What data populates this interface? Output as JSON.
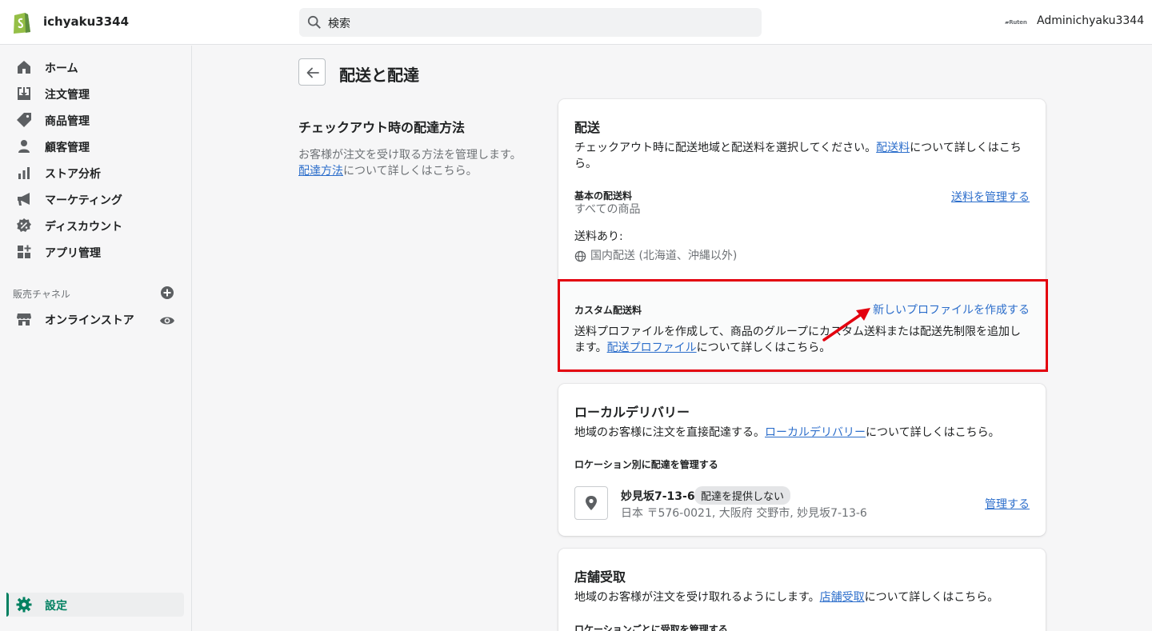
{
  "topbar": {
    "store_name": "ichyaku3344",
    "search_placeholder": "検索",
    "account_logo_text": "Ruten",
    "account_name": "Adminichyaku3344"
  },
  "sidebar": {
    "items": [
      {
        "label": "ホーム",
        "icon": "home-icon"
      },
      {
        "label": "注文管理",
        "icon": "orders-icon"
      },
      {
        "label": "商品管理",
        "icon": "tag-icon"
      },
      {
        "label": "顧客管理",
        "icon": "customer-icon"
      },
      {
        "label": "ストア分析",
        "icon": "analytics-icon"
      },
      {
        "label": "マーケティング",
        "icon": "megaphone-icon"
      },
      {
        "label": "ディスカウント",
        "icon": "discount-icon"
      },
      {
        "label": "アプリ管理",
        "icon": "apps-icon"
      }
    ],
    "channels_label": "販売チャネル",
    "online_store_label": "オンラインストア",
    "settings_label": "設定"
  },
  "page": {
    "title": "配送と配達",
    "left_title": "チェックアウト時の配達方法",
    "left_desc": "お客様が注文を受け取る方法を管理します。",
    "left_link": "配達方法",
    "left_desc_suffix": "について詳しくはこちら。"
  },
  "shipping_card": {
    "title": "配送",
    "desc_prefix": "チェックアウト時に配送地域と配送料を選択してください。",
    "desc_link": "配送料",
    "desc_suffix": "について詳しくはこちら。",
    "basic_label": "基本の配送料",
    "basic_sub": "すべての商品",
    "manage_link": "送料を管理する",
    "rates_label": "送料あり:",
    "zone": "国内配送 (北海道、沖縄以外)",
    "custom_label": "カスタム配送料",
    "create_profile_link": "新しいプロファイルを作成する",
    "custom_desc_prefix": "送料プロファイルを作成して、商品のグループにカスタム送料または配送先制限を追加します。",
    "custom_link": "配送プロファイル",
    "custom_desc_suffix": "について詳しくはこちら。"
  },
  "local_card": {
    "title": "ローカルデリバリー",
    "desc_prefix": "地域のお客様に注文を直接配達する。",
    "desc_link": "ローカルデリバリー",
    "desc_suffix": "について詳しくはこちら。",
    "manage_label": "ロケーション別に配達を管理する",
    "location_name": "妙見坂7-13-6",
    "badge": "配達を提供しない",
    "address": "日本 〒576-0021, 大阪府 交野市, 妙見坂7-13-6",
    "manage_link": "管理する"
  },
  "pickup_card": {
    "title": "店舗受取",
    "desc_prefix": "地域のお客様が注文を受け取れるようにします。",
    "desc_link": "店舗受取",
    "desc_suffix": "について詳しくはこちら。",
    "manage_label": "ロケーションごとに受取を管理する"
  },
  "colors": {
    "accent_green": "#008060",
    "link_blue": "#2c6ecb",
    "highlight_red": "#e3000e"
  }
}
